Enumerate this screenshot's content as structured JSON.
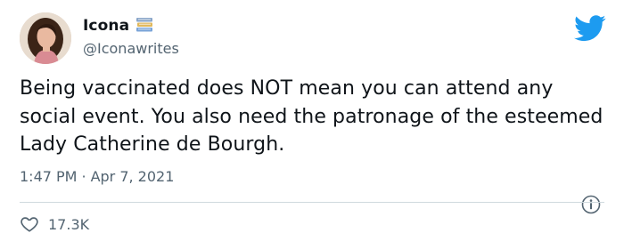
{
  "author": {
    "display_name": "Icona",
    "handle": "@Iconawrites"
  },
  "tweet": {
    "text": "Being vaccinated does NOT mean you can attend any social event. You also need the patronage of the esteemed Lady Catherine de Bourgh.",
    "time": "1:47 PM",
    "separator": "·",
    "date": "Apr 7, 2021"
  },
  "engagement": {
    "likes": "17.3K"
  },
  "icons": {
    "avatar": "avatar-photo",
    "name_badge": "books-icon",
    "brand": "twitter-bird-icon",
    "info": "info-icon",
    "like": "heart-icon"
  },
  "colors": {
    "text": "#0f1419",
    "secondary": "#536471",
    "brand": "#1d9bf0",
    "divider": "#cfd9de"
  }
}
